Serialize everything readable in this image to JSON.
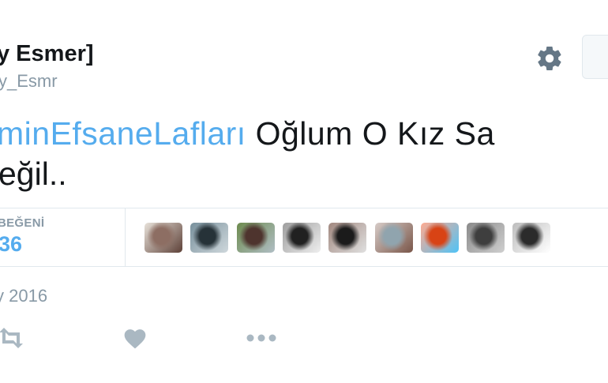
{
  "tweet": {
    "display_name": "y Esmer]",
    "handle": "y_Esmr",
    "text_hashtag": "minEfsaneLafları",
    "text_rest": " Oğlum O Kız Sa",
    "text_line2": "eğil..",
    "timestamp": "y 2016"
  },
  "stats": {
    "likes_label": "BEĞENİ",
    "likes_count": "36"
  },
  "likers": [
    {
      "name": "liker-avatar-1",
      "colors": [
        "#8d6e63",
        "#e8e2da",
        "#5d4037"
      ]
    },
    {
      "name": "liker-avatar-2",
      "colors": [
        "#263238",
        "#78909c",
        "#cfd8dc"
      ]
    },
    {
      "name": "liker-avatar-3",
      "colors": [
        "#4e342e",
        "#6d8b4e",
        "#b0bec5"
      ]
    },
    {
      "name": "liker-avatar-4",
      "colors": [
        "#212121",
        "#9e9e9e",
        "#eeeeee"
      ]
    },
    {
      "name": "liker-avatar-5",
      "colors": [
        "#1b1b1b",
        "#a1887f",
        "#e0e0e0"
      ]
    },
    {
      "name": "liker-avatar-6",
      "colors": [
        "#90a4ae",
        "#d7ccc8",
        "#795548"
      ]
    },
    {
      "name": "liker-avatar-7",
      "colors": [
        "#d84315",
        "#ffab91",
        "#4fc3f7"
      ]
    },
    {
      "name": "liker-avatar-8",
      "colors": [
        "#3e3e3e",
        "#8a8a8a",
        "#cfcfcf"
      ]
    },
    {
      "name": "liker-avatar-9",
      "colors": [
        "#2b2b2b",
        "#bdbdbd",
        "#ffffff"
      ]
    }
  ],
  "colors": {
    "accent": "#55acee",
    "muted": "#8899a6",
    "text": "#14171a",
    "border": "#e1e8ed",
    "icon": "#657786"
  },
  "icons": {
    "settings": "gear-icon",
    "retweet": "retweet-icon",
    "like": "heart-icon",
    "more": "more-dots-icon"
  }
}
